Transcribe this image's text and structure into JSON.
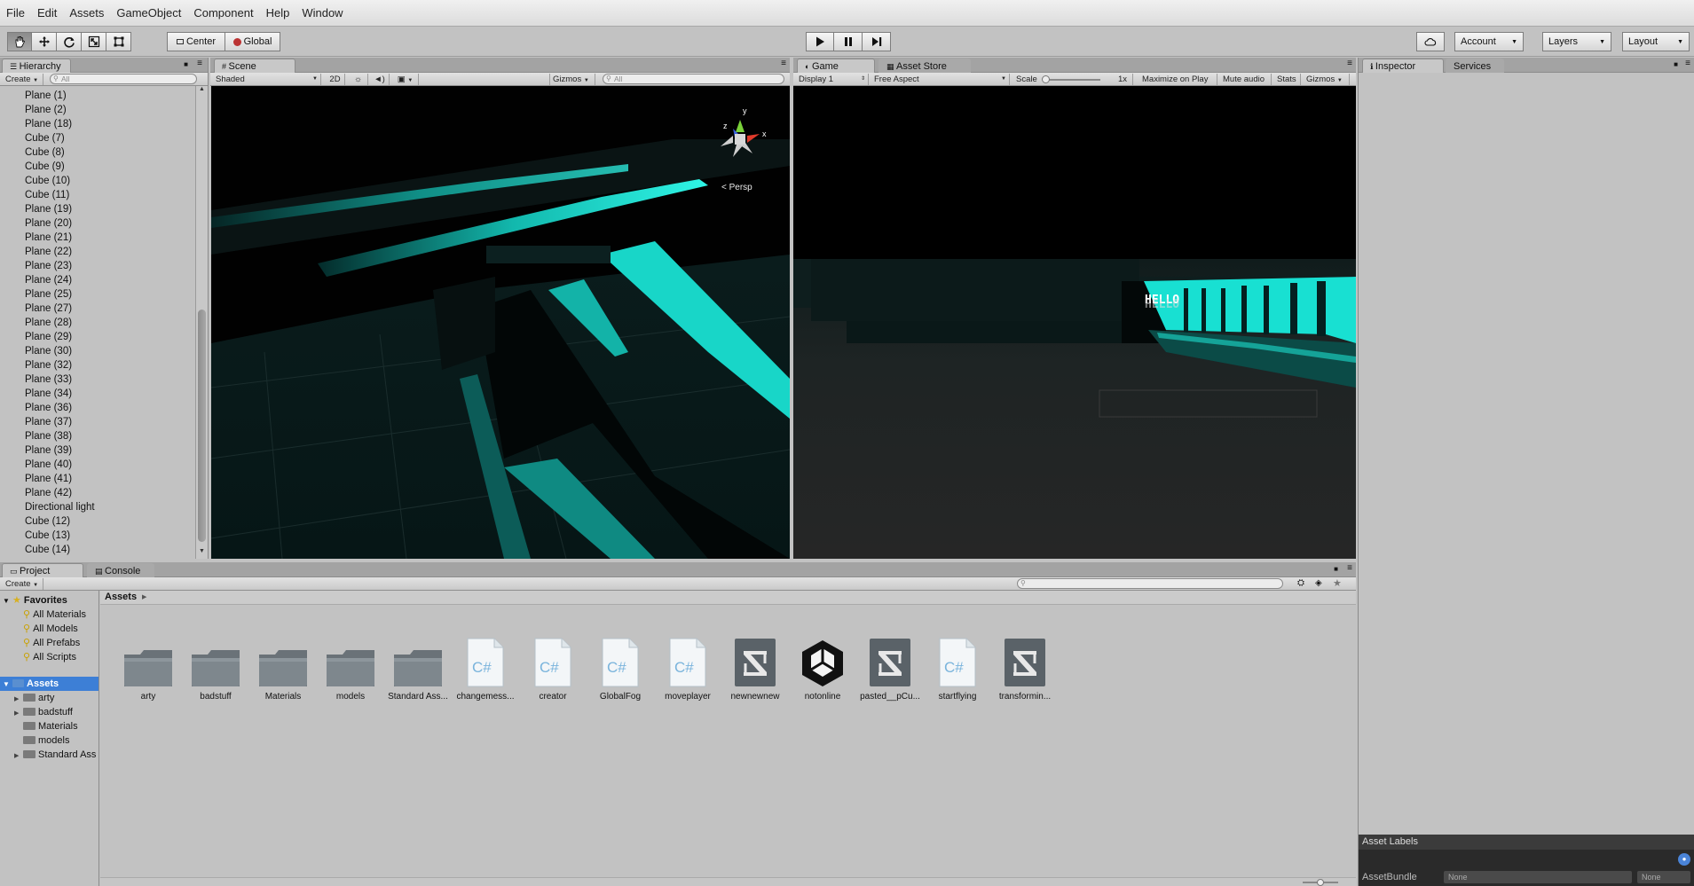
{
  "menu": [
    "File",
    "Edit",
    "Assets",
    "GameObject",
    "Component",
    "Help",
    "Window"
  ],
  "toolbar": {
    "tools": [
      "hand-tool",
      "move-tool",
      "rotate-tool",
      "scale-tool",
      "rect-tool"
    ],
    "pivot": "Center",
    "space": "Global",
    "account": "Account",
    "layers": "Layers",
    "layout": "Layout"
  },
  "hierarchy": {
    "tab": "Hierarchy",
    "create": "Create",
    "search_placeholder": "All",
    "items": [
      "Plane (1)",
      "Plane (2)",
      "Plane (18)",
      "Cube (7)",
      "Cube (8)",
      "Cube (9)",
      "Cube (10)",
      "Cube (11)",
      "Plane (19)",
      "Plane (20)",
      "Plane (21)",
      "Plane (22)",
      "Plane (23)",
      "Plane (24)",
      "Plane (25)",
      "Plane (27)",
      "Plane (28)",
      "Plane (29)",
      "Plane (30)",
      "Plane (32)",
      "Plane (33)",
      "Plane (34)",
      "Plane (36)",
      "Plane (37)",
      "Plane (38)",
      "Plane (39)",
      "Plane (40)",
      "Plane (41)",
      "Plane (42)",
      "Directional light",
      "Cube (12)",
      "Cube (13)",
      "Cube (14)"
    ]
  },
  "scene": {
    "tab": "Scene",
    "shading": "Shaded",
    "mode2d": "2D",
    "gizmos": "Gizmos",
    "search_placeholder": "All",
    "persp": "Persp",
    "axis_y": "y",
    "axis_x": "x",
    "axis_z": "z"
  },
  "game": {
    "tab": "Game",
    "asset_store_tab": "Asset Store",
    "display": "Display 1",
    "aspect": "Free Aspect",
    "scale_label": "Scale",
    "scale_value": "1x",
    "maximize": "Maximize on Play",
    "mute": "Mute audio",
    "stats": "Stats",
    "gizmos": "Gizmos",
    "sign_text": "HELLO"
  },
  "inspector": {
    "tab": "Inspector",
    "services_tab": "Services",
    "asset_labels": "Asset Labels",
    "asset_bundle": "AssetBundle",
    "bundle_value": "None",
    "variant_value": "None"
  },
  "project": {
    "tab": "Project",
    "console_tab": "Console",
    "create": "Create",
    "favorites_label": "Favorites",
    "favorites": [
      "All Materials",
      "All Models",
      "All Prefabs",
      "All Scripts"
    ],
    "assets_label": "Assets",
    "folders": [
      "arty",
      "badstuff",
      "Materials",
      "models",
      "Standard Ass"
    ],
    "breadcrumb": "Assets",
    "assets": [
      {
        "name": "arty",
        "kind": "folder"
      },
      {
        "name": "badstuff",
        "kind": "folder"
      },
      {
        "name": "Materials",
        "kind": "folder"
      },
      {
        "name": "models",
        "kind": "folder"
      },
      {
        "name": "Standard Ass...",
        "kind": "folder"
      },
      {
        "name": "changemess...",
        "kind": "script"
      },
      {
        "name": "creator",
        "kind": "script"
      },
      {
        "name": "GlobalFog",
        "kind": "script"
      },
      {
        "name": "moveplayer",
        "kind": "script"
      },
      {
        "name": "newnewnew",
        "kind": "prefab"
      },
      {
        "name": "notonline",
        "kind": "unity"
      },
      {
        "name": "pasted__pCu...",
        "kind": "prefab"
      },
      {
        "name": "startflying",
        "kind": "script"
      },
      {
        "name": "transformin...",
        "kind": "prefab"
      }
    ]
  },
  "colors": {
    "accent": "#3d7fd6",
    "cyan": "#17e6d8",
    "panel": "#c2c2c2"
  }
}
